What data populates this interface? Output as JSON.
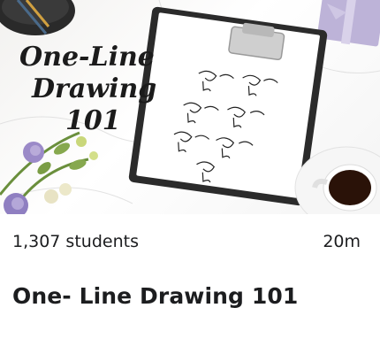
{
  "course": {
    "thumbnail": {
      "title_line1": "One-Line",
      "title_line2": "Drawing",
      "title_line3": "101"
    },
    "students": "1,307 students",
    "duration": "20m",
    "title": "One- Line Drawing 101"
  }
}
